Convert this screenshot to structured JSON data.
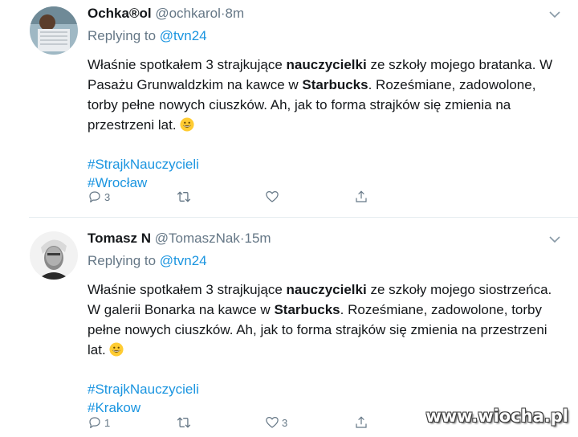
{
  "tweets": [
    {
      "name": "Ochka®ol",
      "handle": "@ochkarol",
      "dot": "·",
      "time": "8m",
      "replying_prefix": "Replying to",
      "replying_to": "@tvn24",
      "body": [
        {
          "t": "Właśnie spotkałem 3 strajkujące "
        },
        {
          "t": "nauczycielki",
          "b": true
        },
        {
          "t": " ze szkoły mojego bratanka. W Pasażu Grunwaldzkim na kawce w "
        },
        {
          "t": "Starbucks",
          "b": true
        },
        {
          "t": ". Roześmiane, zadowolone, torby pełne nowych ciuszków. Ah, jak to forma strajków się zmienia na przestrzeni lat."
        }
      ],
      "hashtags": [
        "#StrajkNauczycieli",
        "#Wrocław"
      ],
      "reply_count": "3",
      "retweet_count": "",
      "like_count": ""
    },
    {
      "name": "Tomasz N",
      "handle": "@TomaszNak",
      "dot": "·",
      "time": "15m",
      "replying_prefix": "Replying to",
      "replying_to": "@tvn24",
      "body": [
        {
          "t": "Właśnie spotkałem 3 strajkujące "
        },
        {
          "t": "nauczycielki",
          "b": true
        },
        {
          "t": " ze szkoły mojego siostrzeńca. W galerii Bonarka na kawce w "
        },
        {
          "t": "Starbucks",
          "b": true
        },
        {
          "t": ". Roześmiane, zadowolone, torby pełne nowych ciuszków. Ah, jak to forma strajków się zmienia na przestrzeni lat."
        }
      ],
      "hashtags": [
        "#StrajkNauczycieli",
        "#Krakow"
      ],
      "reply_count": "1",
      "retweet_count": "",
      "like_count": "3"
    }
  ],
  "watermark": "www.wiocha.pl",
  "colors": {
    "link": "#1b95e0",
    "muted": "#657786",
    "text": "#14171a",
    "divider": "#e6ecf0"
  },
  "icons": [
    "reply-icon",
    "retweet-icon",
    "like-icon",
    "share-icon",
    "caret-down-icon",
    "grinning-emoji"
  ]
}
